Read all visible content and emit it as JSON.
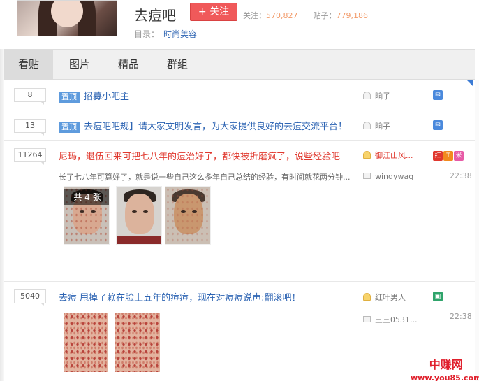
{
  "header": {
    "bar_name": "去痘吧",
    "follow_label": "+ 关注",
    "followers_label": "关注：",
    "followers_value": "570,827",
    "posts_label": "贴子：",
    "posts_value": "779,186",
    "directory_label": "目录：",
    "directory_value": "时尚美容"
  },
  "tabs": [
    {
      "label": "看贴",
      "active": true
    },
    {
      "label": "图片",
      "active": false
    },
    {
      "label": "精品",
      "active": false
    },
    {
      "label": "群组",
      "active": false
    }
  ],
  "threads": [
    {
      "reply_count": "8",
      "tag": "置顶",
      "title": "招募小吧主",
      "author": "晌子",
      "badge_icon": "mail-icon"
    },
    {
      "reply_count": "13",
      "tag": "置顶",
      "title": "去痘吧吧规】请大家文明发言，为大家提供良好的去痘交流平台！",
      "author": "晌子",
      "badge_icon": "mail-icon"
    },
    {
      "reply_count": "11264",
      "title": "尼玛，退伍回来可把七八年的痘治好了，都快被折磨疯了，说些经验吧",
      "author": "御江山风...",
      "badges": [
        "红",
        "T",
        "米"
      ],
      "excerpt": "长了七八年可算好了，就是说一些自己这么多年自己总结的经验，有时间就花两分钟...",
      "last_reply_user": "windywaq",
      "time": "22:38",
      "image_count_label": "共 4 张"
    },
    {
      "reply_count": "5040",
      "title": "去痘 甩掉了赖在脸上五年的痘痘，现在对痘痘说声:翻滚吧！",
      "author": "红叶男人",
      "badge_icon": "jade-icon",
      "last_reply_user": "三三0531...",
      "time": "22:38"
    }
  ],
  "watermark": {
    "name": "中赚网",
    "url": "www.you85.com"
  },
  "colors": {
    "accent_blue": "#2d64b3",
    "follow_red": "#f0595a",
    "hot_title_red": "#e0382e",
    "tag_blue": "#5e9bdd"
  }
}
